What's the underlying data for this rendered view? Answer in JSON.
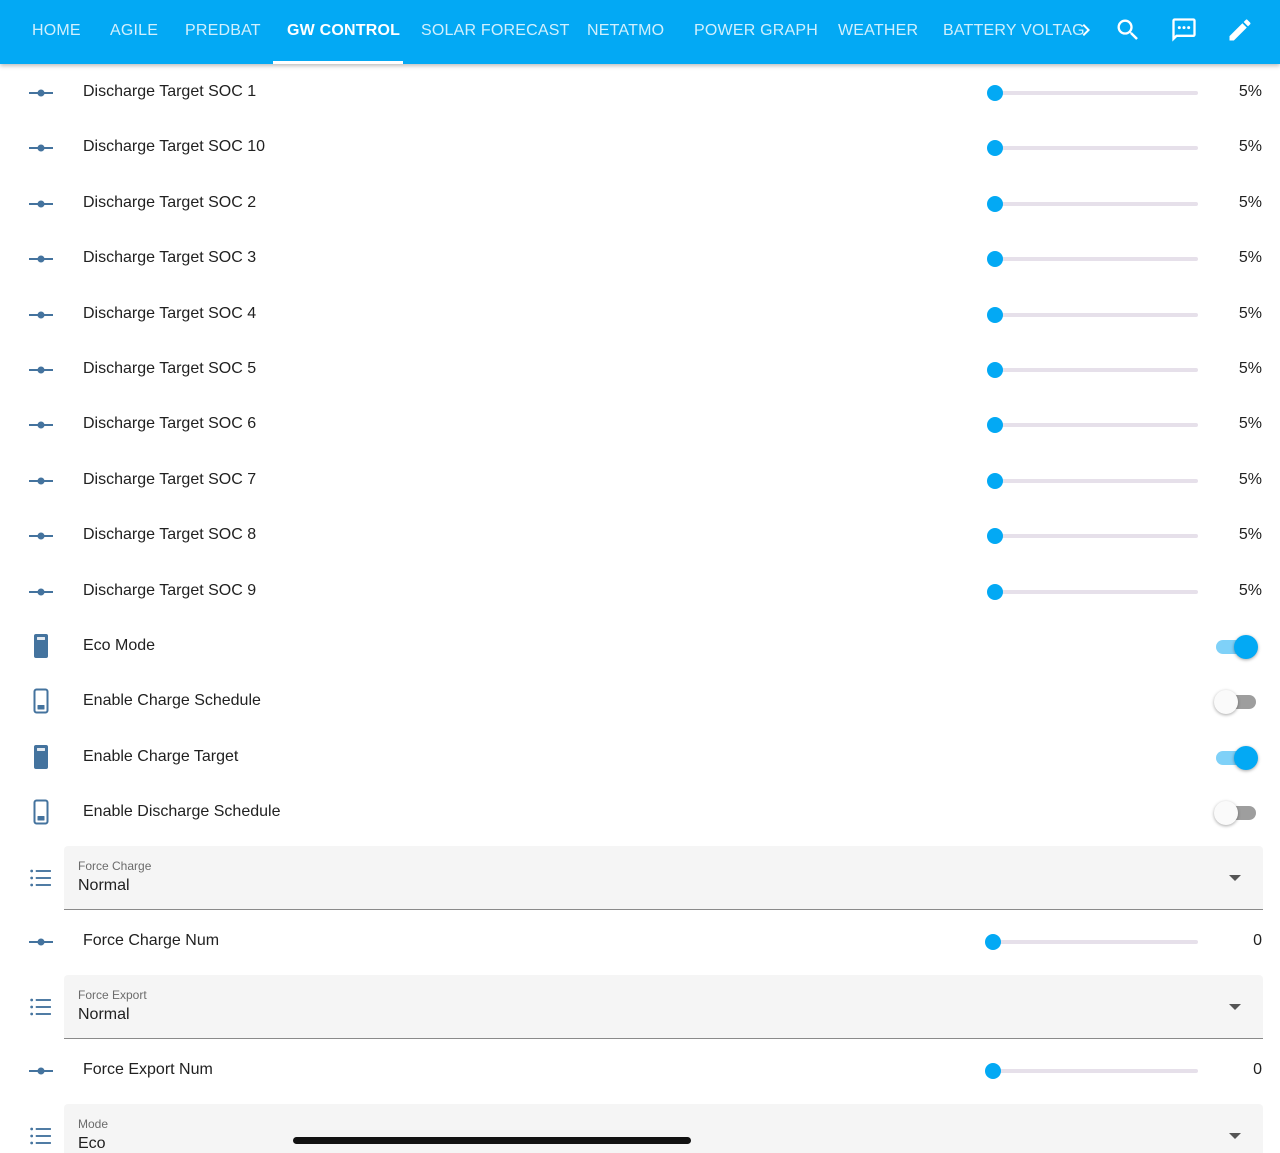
{
  "toolbar": {
    "tabs": [
      {
        "label": "HOME"
      },
      {
        "label": "AGILE"
      },
      {
        "label": "PREDBAT"
      },
      {
        "label": "GW CONTROL"
      },
      {
        "label": "SOLAR FORECAST"
      },
      {
        "label": "NETATMO"
      },
      {
        "label": "POWER GRAPH"
      },
      {
        "label": "WEATHER"
      },
      {
        "label": "BATTERY VOLTAG"
      }
    ],
    "active_tab": "GW CONTROL",
    "icons": [
      "chevron-right-icon",
      "search-icon",
      "assist-message-icon",
      "pencil-icon"
    ]
  },
  "colors": {
    "primary": "#03a9f4",
    "entity_icon": "#44739e",
    "slider_track": "#e6e0ea",
    "toggle_off_track": "#9e9e9e"
  },
  "sliders": [
    {
      "label": "Discharge Target SOC 1",
      "value": "5%",
      "level": 0.0
    },
    {
      "label": "Discharge Target SOC 10",
      "value": "5%",
      "level": 0.0
    },
    {
      "label": "Discharge Target SOC 2",
      "value": "5%",
      "level": 0.0
    },
    {
      "label": "Discharge Target SOC 3",
      "value": "5%",
      "level": 0.0
    },
    {
      "label": "Discharge Target SOC 4",
      "value": "5%",
      "level": 0.0
    },
    {
      "label": "Discharge Target SOC 5",
      "value": "5%",
      "level": 0.0
    },
    {
      "label": "Discharge Target SOC 6",
      "value": "5%",
      "level": 0.0
    },
    {
      "label": "Discharge Target SOC 7",
      "value": "5%",
      "level": 0.0
    },
    {
      "label": "Discharge Target SOC 8",
      "value": "5%",
      "level": 0.0
    },
    {
      "label": "Discharge Target SOC 9",
      "value": "5%",
      "level": 0.0
    }
  ],
  "switches": [
    {
      "label": "Eco Mode",
      "on": true
    },
    {
      "label": "Enable Charge Schedule",
      "on": false
    },
    {
      "label": "Enable Charge Target",
      "on": true
    },
    {
      "label": "Enable Discharge Schedule",
      "on": false
    }
  ],
  "force_charge": {
    "caption": "Force Charge",
    "value": "Normal"
  },
  "force_charge_num": {
    "label": "Force Charge Num",
    "value": "0",
    "level": 0.0
  },
  "force_export": {
    "caption": "Force Export",
    "value": "Normal"
  },
  "force_export_num": {
    "label": "Force Export Num",
    "value": "0",
    "level": 0.0
  },
  "mode": {
    "caption": "Mode",
    "value": "Eco"
  }
}
